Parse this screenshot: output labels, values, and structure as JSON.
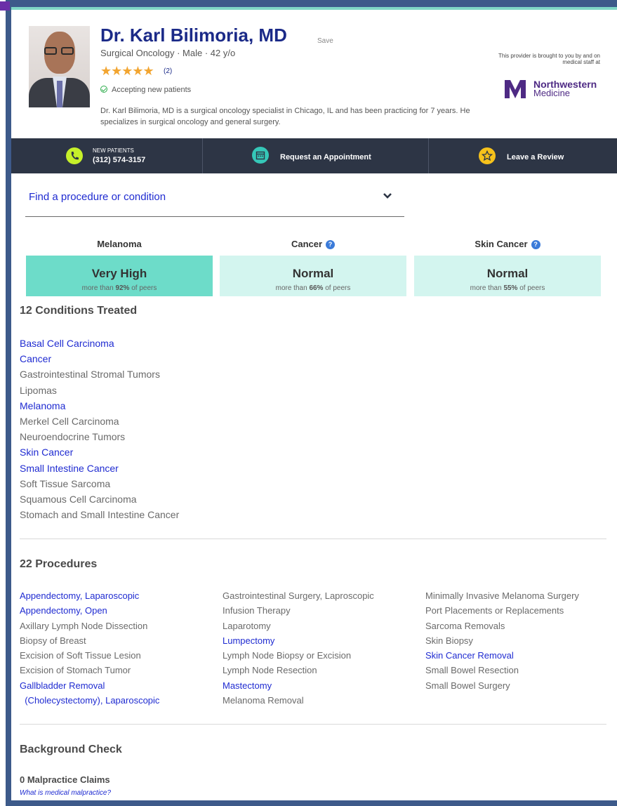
{
  "doctor": {
    "name": "Dr. Karl Bilimoria, MD",
    "save_label": "Save",
    "subline": "Surgical Oncology · Male · 42 y/o",
    "rating_stars": 5,
    "review_count": "(2)",
    "accepting": "Accepting new patients",
    "bio": "Dr. Karl Bilimoria, MD is a surgical oncology specialist in Chicago, IL and has been practicing for 7 years. He specializes in surgical oncology and general surgery."
  },
  "provider": {
    "note": "This provider is brought to you by and on medical staff at",
    "logo_line1": "Northwestern",
    "logo_line2": "Medicine",
    "logo_color": "#4e2a84"
  },
  "actions": {
    "phone_small": "NEW PATIENTS",
    "phone": "(312) 574-3157",
    "appointment": "Request an Appointment",
    "review": "Leave a Review"
  },
  "search": {
    "placeholder": "Find a procedure or condition"
  },
  "ratings": [
    {
      "name": "Melanoma",
      "help": false,
      "level": "Very High",
      "prefix": "more than ",
      "percent": "92%",
      "suffix": " of peers",
      "color": "#6ddcc9"
    },
    {
      "name": "Cancer",
      "help": true,
      "level": "Normal",
      "prefix": "more than ",
      "percent": "66%",
      "suffix": " of peers",
      "color": "#d3f5ef"
    },
    {
      "name": "Skin Cancer",
      "help": true,
      "level": "Normal",
      "prefix": "more than ",
      "percent": "55%",
      "suffix": " of peers",
      "color": "#d3f5ef"
    }
  ],
  "conditions": {
    "title": "12  Conditions Treated",
    "items": [
      {
        "label": "Basal Cell Carcinoma",
        "link": true
      },
      {
        "label": "Cancer",
        "link": true
      },
      {
        "label": "Gastrointestinal Stromal Tumors",
        "link": false
      },
      {
        "label": "Lipomas",
        "link": false
      },
      {
        "label": "Melanoma",
        "link": true
      },
      {
        "label": "Merkel Cell Carcinoma",
        "link": false
      },
      {
        "label": "Neuroendocrine Tumors",
        "link": false
      },
      {
        "label": "Skin Cancer",
        "link": true
      },
      {
        "label": "Small Intestine Cancer",
        "link": true
      },
      {
        "label": "Soft Tissue Sarcoma",
        "link": false
      },
      {
        "label": "Squamous Cell Carcinoma",
        "link": false
      },
      {
        "label": "Stomach and Small Intestine Cancer",
        "link": false
      }
    ]
  },
  "procedures": {
    "title": "22  Procedures",
    "columns": [
      [
        {
          "label": "Appendectomy, Laparoscopic",
          "link": true
        },
        {
          "label": "Appendectomy, Open",
          "link": true
        },
        {
          "label": "Axillary Lymph Node Dissection",
          "link": false
        },
        {
          "label": "Biopsy of Breast",
          "link": false
        },
        {
          "label": "Excision of Soft Tissue Lesion",
          "link": false
        },
        {
          "label": "Excision of Stomach Tumor",
          "link": false
        },
        {
          "label": "Gallbladder Removal",
          "link": true
        },
        {
          "label": "  (Cholecystectomy), Laparoscopic",
          "link": true
        }
      ],
      [
        {
          "label": "Gastrointestinal Surgery, Laproscopic",
          "link": false
        },
        {
          "label": "Infusion Therapy",
          "link": false
        },
        {
          "label": "Laparotomy",
          "link": false
        },
        {
          "label": "Lumpectomy",
          "link": true
        },
        {
          "label": "Lymph Node Biopsy or Excision",
          "link": false
        },
        {
          "label": "Lymph Node Resection",
          "link": false
        },
        {
          "label": "Mastectomy",
          "link": true
        },
        {
          "label": "Melanoma Removal",
          "link": false
        }
      ],
      [
        {
          "label": "Minimally Invasive Melanoma Surgery",
          "link": false
        },
        {
          "label": "Port Placements or Replacements",
          "link": false
        },
        {
          "label": "Sarcoma Removals",
          "link": false
        },
        {
          "label": "Skin Biopsy",
          "link": false
        },
        {
          "label": "Skin Cancer Removal",
          "link": true
        },
        {
          "label": "Small Bowel Resection",
          "link": false
        },
        {
          "label": "Small Bowel Surgery",
          "link": false
        }
      ]
    ]
  },
  "background": {
    "title": "Background Check",
    "malpractice": "0 Malpractice Claims",
    "malpractice_link": "What is medical malpractice?"
  }
}
